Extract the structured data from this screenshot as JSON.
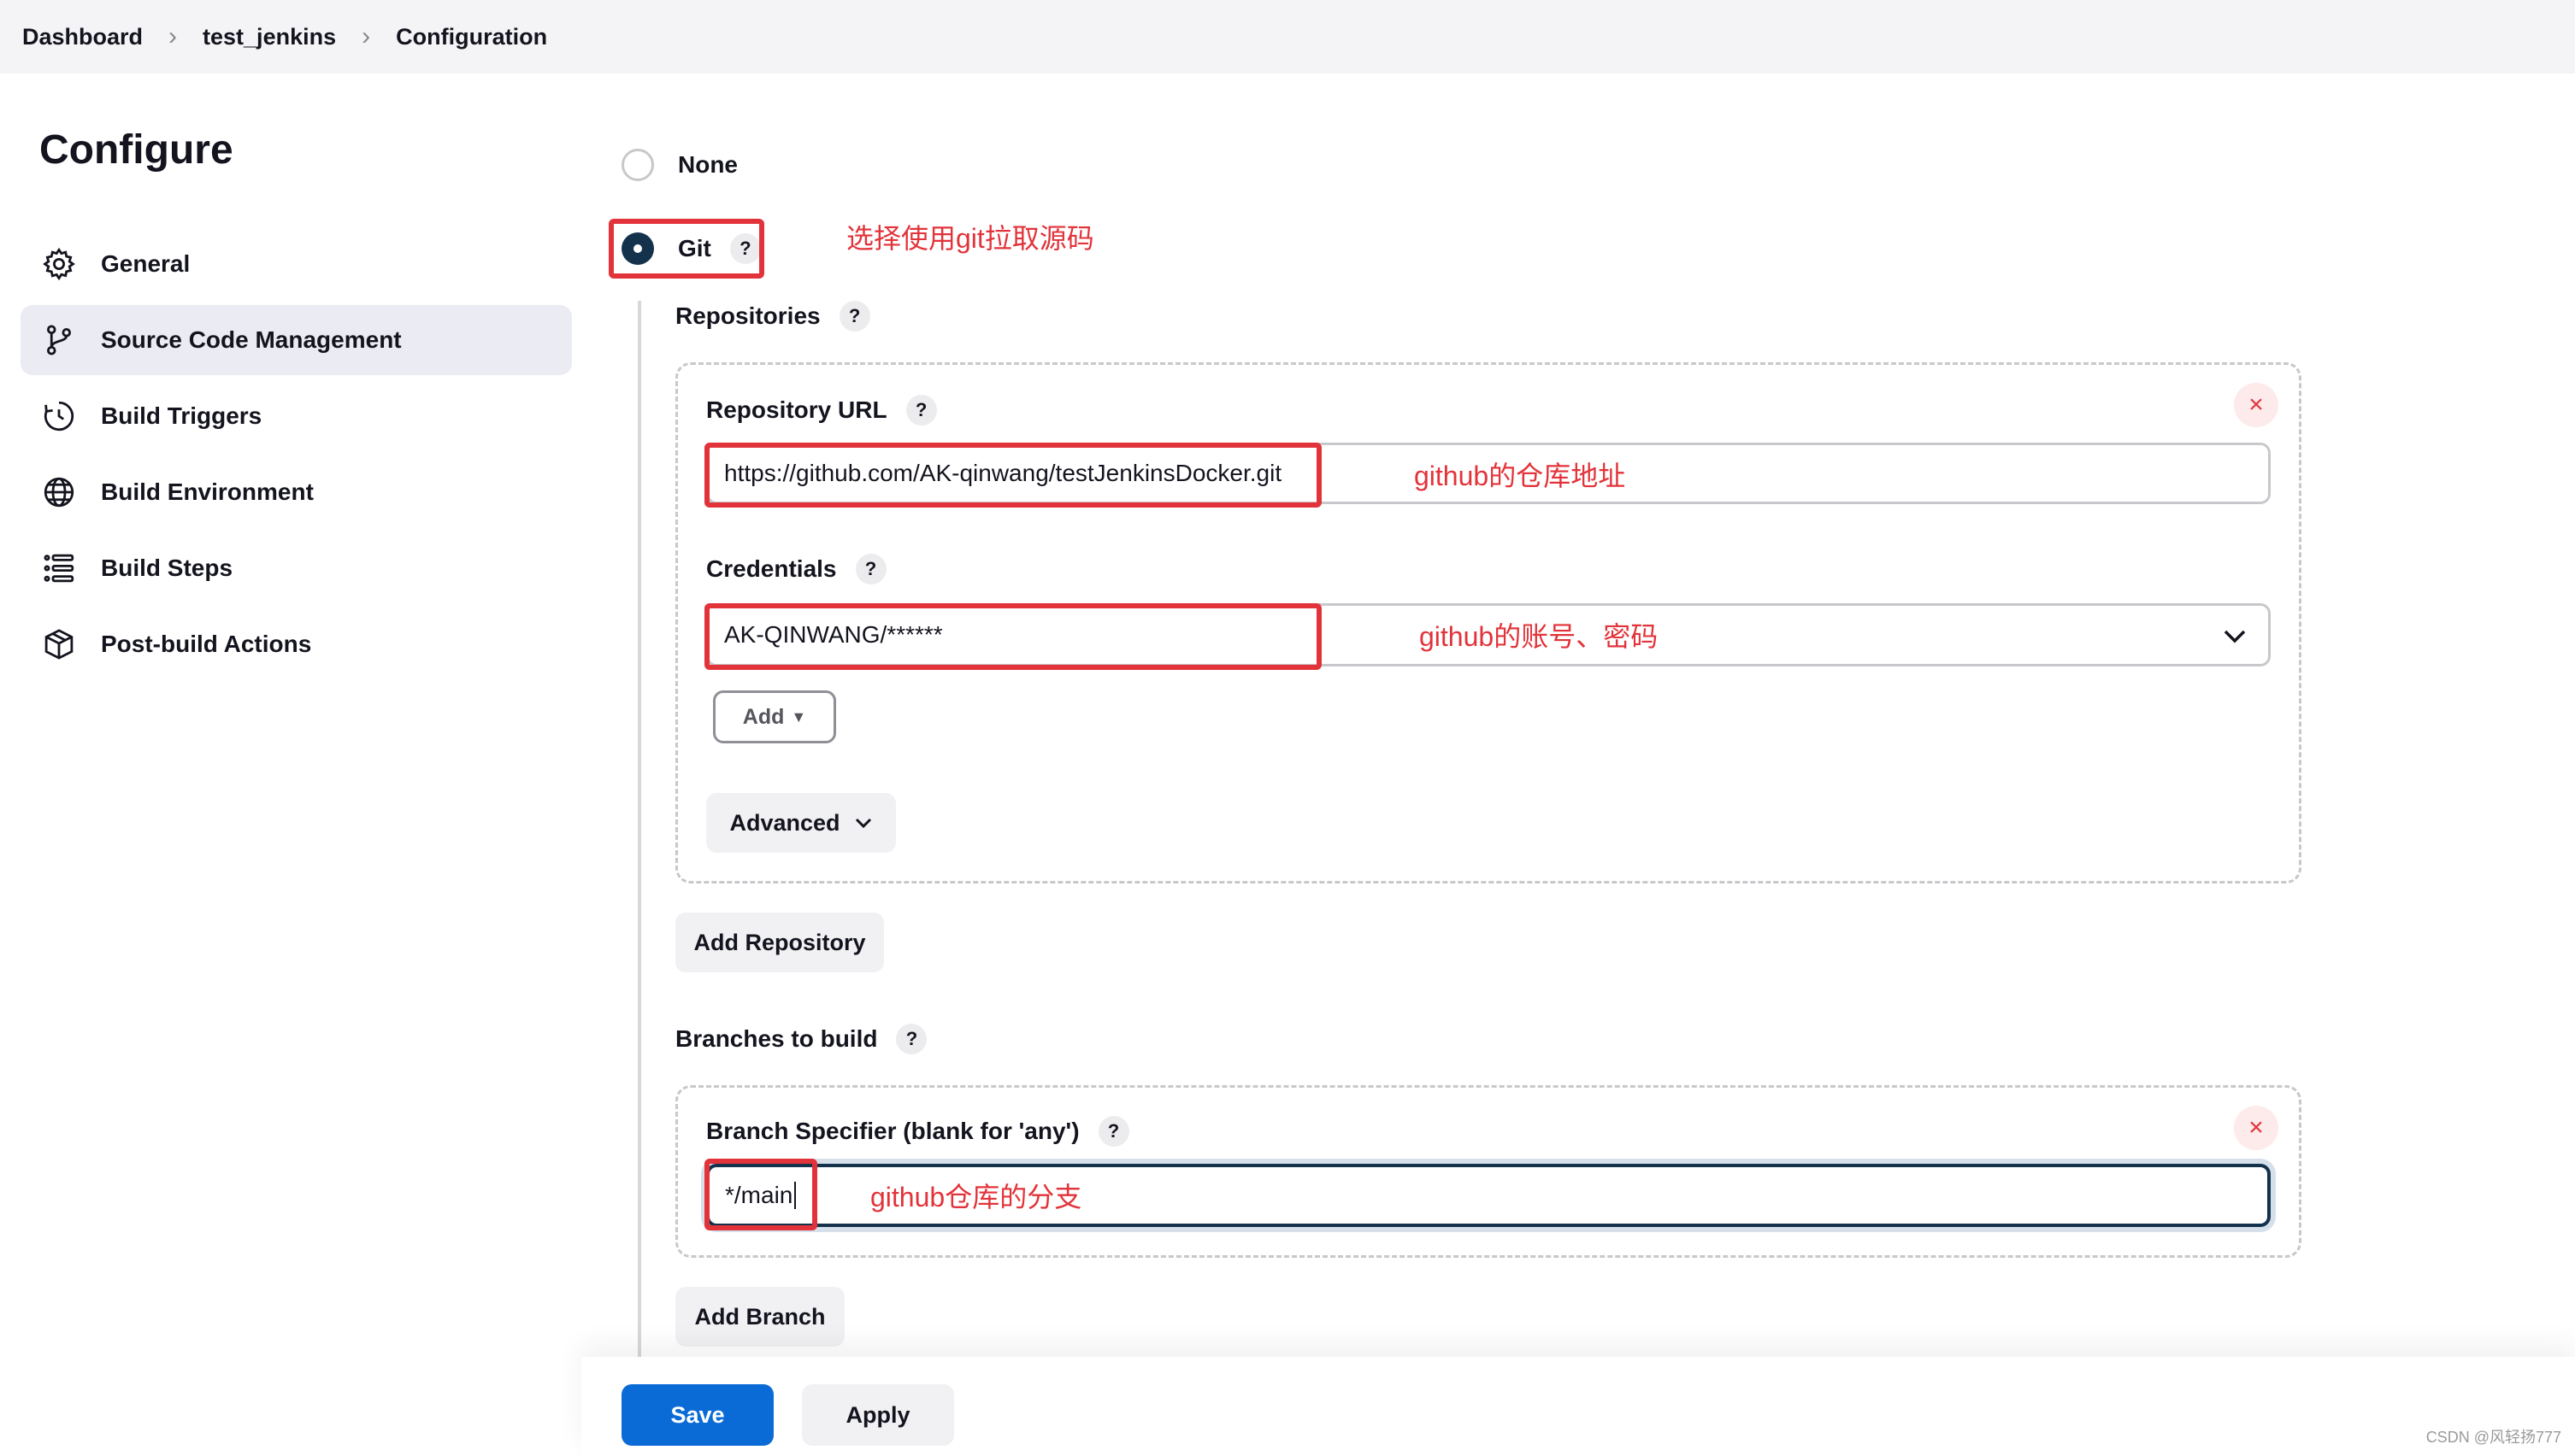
{
  "breadcrumb": [
    "Dashboard",
    "test_jenkins",
    "Configuration"
  ],
  "page_title": "Configure",
  "sidebar": {
    "items": [
      {
        "label": "General",
        "icon": "gear-icon"
      },
      {
        "label": "Source Code Management",
        "icon": "branch-icon",
        "active": true
      },
      {
        "label": "Build Triggers",
        "icon": "clock-icon"
      },
      {
        "label": "Build Environment",
        "icon": "globe-icon"
      },
      {
        "label": "Build Steps",
        "icon": "list-icon"
      },
      {
        "label": "Post-build Actions",
        "icon": "box-icon"
      }
    ]
  },
  "scm": {
    "options": {
      "none": "None",
      "git": "Git"
    },
    "selected": "Git",
    "help": "?",
    "repositories_label": "Repositories",
    "repository_url_label": "Repository URL",
    "repository_url_value": "https://github.com/AK-qinwang/testJenkinsDocker.git",
    "credentials_label": "Credentials",
    "credentials_value": "AK-QINWANG/******",
    "add_label": "Add",
    "advanced_label": "Advanced",
    "add_repository_label": "Add Repository",
    "branches_label": "Branches to build",
    "branch_specifier_label": "Branch Specifier (blank for 'any')",
    "branch_specifier_value": "*/main",
    "add_branch_label": "Add Branch",
    "remove_symbol": "×"
  },
  "annotations": {
    "git": "选择使用git拉取源码",
    "url": "github的仓库地址",
    "credentials": "github的账号、密码",
    "branch": "github仓库的分支"
  },
  "footer": {
    "save": "Save",
    "apply": "Apply"
  },
  "watermark": "CSDN @风轻扬777",
  "colors": {
    "annotation_red": "#e2333a",
    "radio_selected": "#15324d",
    "save_blue": "#0b6bd6"
  }
}
